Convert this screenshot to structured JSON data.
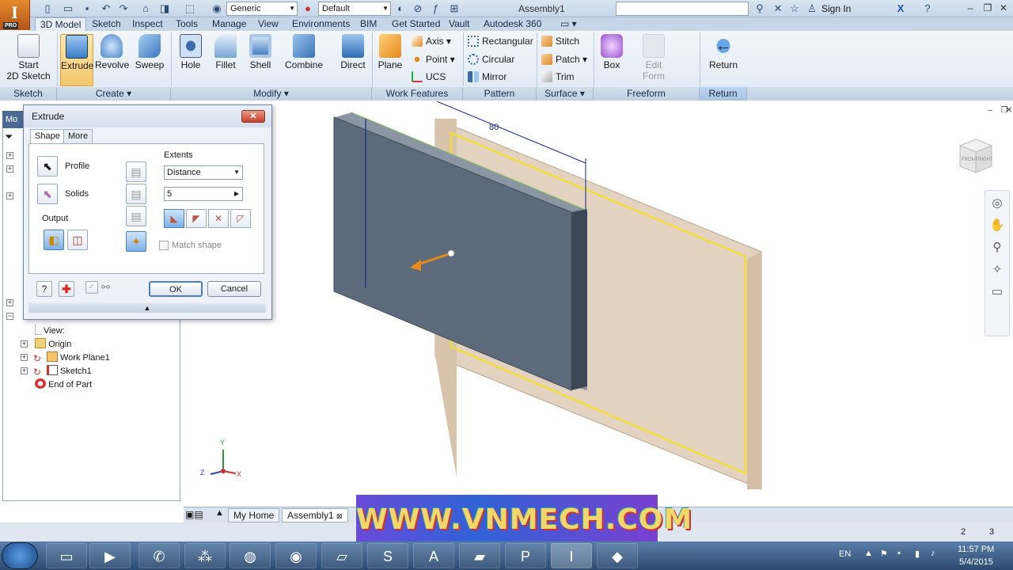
{
  "app": {
    "logo_text": "I",
    "logo_edition": "PRO",
    "document_title": "Assembly1",
    "material_combo": "Generic",
    "appearance_combo": "Default",
    "sign_in": "Sign In"
  },
  "ribbon_tabs": [
    "3D Model",
    "Sketch",
    "Inspect",
    "Tools",
    "Manage",
    "View",
    "Environments",
    "BIM",
    "Get Started",
    "Vault",
    "Autodesk 360"
  ],
  "ribbon": {
    "sketch": {
      "start_line1": "Start",
      "start_line2": "2D Sketch",
      "panel": "Sketch"
    },
    "create": {
      "extrude": "Extrude",
      "revolve": "Revolve",
      "sweep": "Sweep",
      "panel": "Create ▾"
    },
    "modify": {
      "hole": "Hole",
      "fillet": "Fillet",
      "shell": "Shell",
      "combine": "Combine",
      "direct": "Direct",
      "panel": "Modify ▾"
    },
    "work_features": {
      "plane": "Plane",
      "axis": "Axis",
      "point": "Point",
      "ucs": "UCS",
      "panel": "Work Features"
    },
    "pattern": {
      "rectangular": "Rectangular",
      "circular": "Circular",
      "mirror": "Mirror",
      "panel": "Pattern"
    },
    "surface": {
      "stitch": "Stitch",
      "patch": "Patch",
      "trim": "Trim",
      "panel": "Surface ▾"
    },
    "freeform": {
      "box": "Box",
      "edit_form_line1": "Edit",
      "edit_form_line2": "Form",
      "panel": "Freeform"
    },
    "return": {
      "return": "Return",
      "panel": "Return"
    }
  },
  "browser": {
    "header": "Mo",
    "items": [
      "View:",
      "Origin",
      "Work Plane1",
      "Sketch1",
      "End of Part"
    ]
  },
  "dialog": {
    "title": "Extrude",
    "close": "✕",
    "tabs": [
      "Shape",
      "More"
    ],
    "profile": "Profile",
    "solids": "Solids",
    "output": "Output",
    "extents": "Extents",
    "extents_type": "Distance",
    "distance_value": "5",
    "match_shape": "Match shape",
    "ok": "OK",
    "cancel": "Cancel"
  },
  "viewport": {
    "dimension_80": "80",
    "viewcube_front": "FRONT",
    "viewcube_right": "RIGHT",
    "axis_x": "X",
    "axis_y": "Y",
    "axis_z": "Z"
  },
  "bottom_tabs": [
    "My Home",
    "Assembly1"
  ],
  "status": {
    "count_a": "2",
    "count_b": "3"
  },
  "watermark": "WWW.VNMECH.COM",
  "tray": {
    "lang": "EN",
    "time": "11:57 PM",
    "date": "5/4/2015"
  },
  "colors": {
    "accent": "#f5c86a",
    "sketch_yellow": "#f3e21a",
    "part_dark": "#5d6a7c",
    "plane_tan": "#d8c4ad"
  }
}
